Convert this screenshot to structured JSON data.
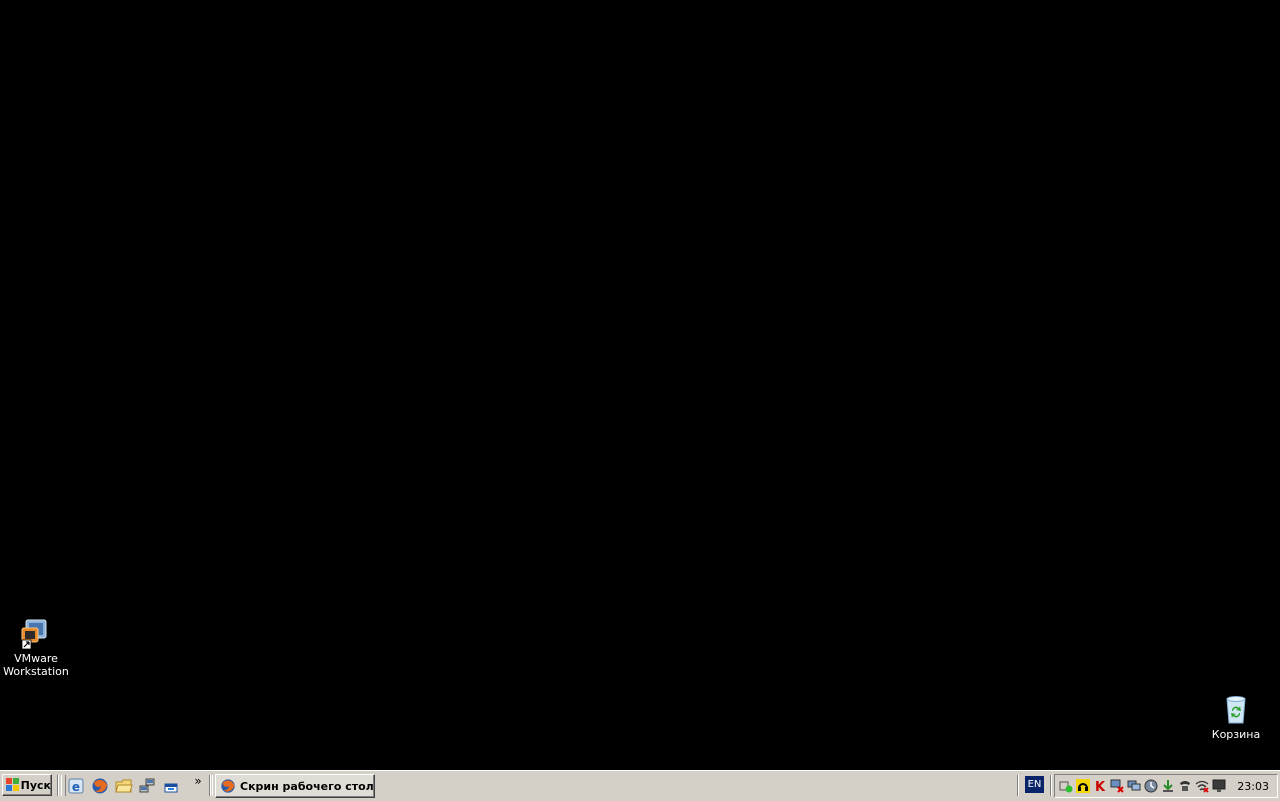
{
  "desktop": {
    "background_color": "#000000",
    "icons": [
      {
        "name": "vmware-workstation",
        "label_line1": "VMware",
        "label_line2": "Workstation",
        "icon": "vmware-icon",
        "shortcut": true
      },
      {
        "name": "recycle-bin",
        "label": "Корзина",
        "icon": "recycle-bin-icon"
      }
    ]
  },
  "taskbar": {
    "start_label": "Пуск",
    "quicklaunch": [
      {
        "icon": "ie-icon"
      },
      {
        "icon": "firefox-icon"
      },
      {
        "icon": "folder-icon"
      },
      {
        "icon": "network-icon"
      },
      {
        "icon": "show-desktop-icon"
      }
    ],
    "quicklaunch_more": "»",
    "tasks": [
      {
        "label": "Скрин рабочего стол...",
        "icon": "firefox-icon",
        "active": false
      }
    ],
    "language": "EN",
    "tray_icons": [
      "green-status-icon",
      "headset-icon",
      "kaspersky-icon",
      "network-disconnected-icon",
      "monitor-icon",
      "clock-sync-icon",
      "download-icon",
      "phone-icon",
      "wifi-icon",
      "display-icon"
    ],
    "clock": "23:03"
  }
}
